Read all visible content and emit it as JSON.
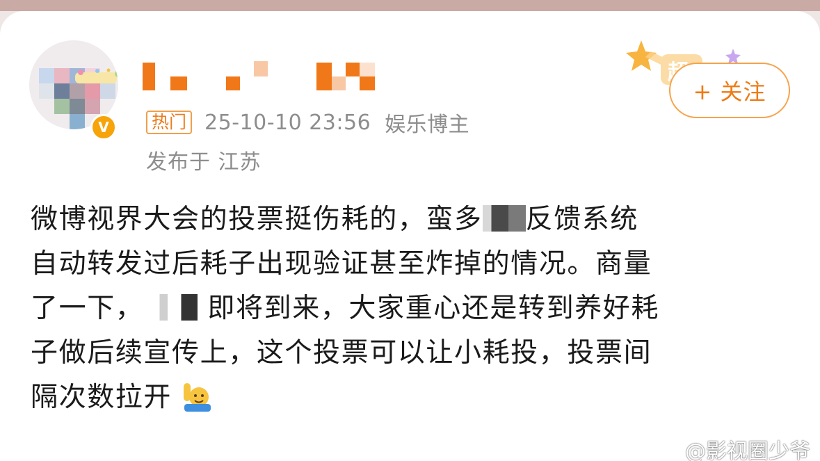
{
  "header": {
    "hot_badge": "热门",
    "timestamp": "25-10-10 23:56",
    "role": "娱乐博主",
    "location": "发布于 江苏",
    "verified_mark": "V",
    "follow_label": "+ 关注",
    "deco_text": "超"
  },
  "post": {
    "line1_a": "微博视界大会的投票挺伤耗的，蛮多",
    "line1_b": "反馈系统",
    "line2": "自动转发过后耗子出现验证甚至炸掉的情况。商量",
    "line3_a": "了一下，",
    "line3_b": "即将到来，大家重心还是转到养好耗",
    "line4": "子做后续宣传上，这个投票可以让小耗投，投票间",
    "line5": "隔次数拉开"
  },
  "watermark": {
    "text": "@影视圈少爷"
  },
  "colors": {
    "accent": "#ee7a14",
    "meta_gray": "#8d8d8d",
    "text": "#1a1a1a",
    "verified": "#f7a30a"
  }
}
